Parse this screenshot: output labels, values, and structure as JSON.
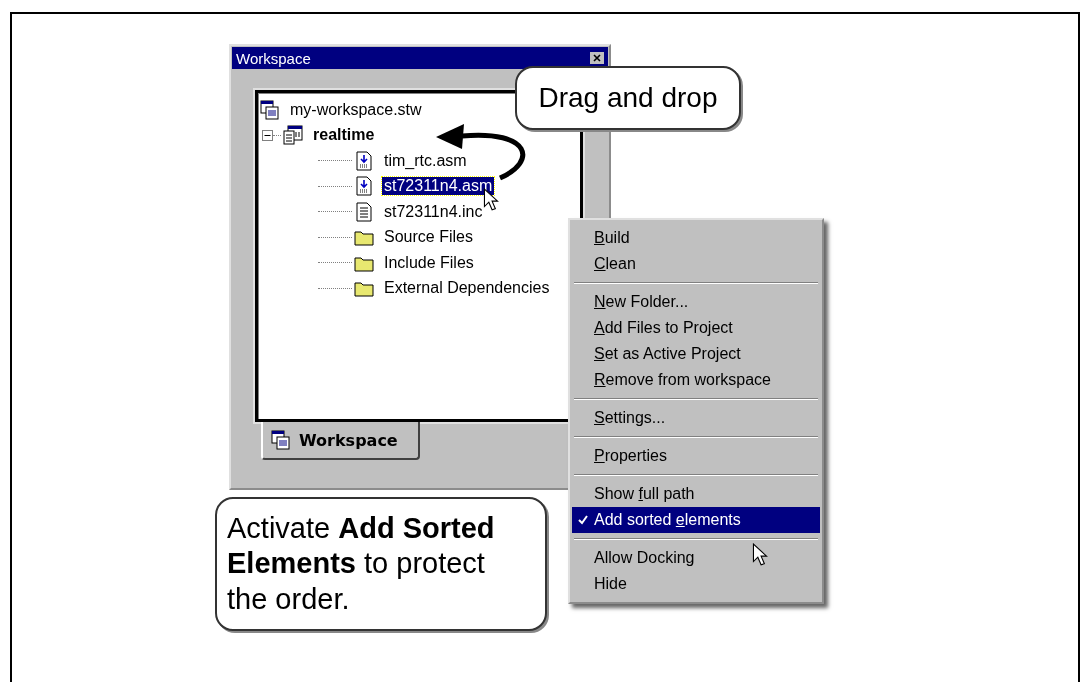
{
  "window": {
    "title": "Workspace"
  },
  "tree": [
    {
      "label": "my-workspace.stw",
      "kind": "workspace",
      "selected": false,
      "children": [
        {
          "label": "realtime",
          "kind": "project",
          "bold": true,
          "expanded": true,
          "selected": false,
          "children": [
            {
              "label": "tim_rtc.asm",
              "kind": "asm",
              "selected": false
            },
            {
              "label": "st72311n4.asm",
              "kind": "asm",
              "selected": true
            },
            {
              "label": "st72311n4.inc",
              "kind": "inc",
              "selected": false
            },
            {
              "label": "Source Files",
              "kind": "folder",
              "selected": false
            },
            {
              "label": "Include Files",
              "kind": "folder",
              "selected": false
            },
            {
              "label": "External Dependencies",
              "kind": "folder",
              "selected": false
            }
          ]
        }
      ]
    }
  ],
  "tabs": [
    {
      "label": "Workspace",
      "selected": true
    }
  ],
  "callouts": [
    {
      "text": "Drag and drop"
    },
    {
      "text": "Activate **Add Sorted Elements** to protect the order."
    }
  ],
  "context_menu": [
    {
      "kind": "item",
      "key": "B",
      "post": "uild",
      "checked": false,
      "selected": false
    },
    {
      "kind": "item",
      "key": "C",
      "post": "lean",
      "checked": false,
      "selected": false
    },
    {
      "kind": "separator"
    },
    {
      "kind": "item",
      "key": "N",
      "post": "ew Folder...",
      "checked": false,
      "selected": false
    },
    {
      "kind": "item",
      "key": "A",
      "post": "dd Files to Project",
      "checked": false,
      "selected": false
    },
    {
      "kind": "item",
      "key": "S",
      "post": "et as Active Project",
      "checked": false,
      "selected": false
    },
    {
      "kind": "item",
      "key": "R",
      "post": "emove from workspace",
      "checked": false,
      "selected": false
    },
    {
      "kind": "separator"
    },
    {
      "kind": "item",
      "key": "S",
      "post": "ettings...",
      "checked": false,
      "selected": false
    },
    {
      "kind": "separator"
    },
    {
      "kind": "item",
      "key": "P",
      "post": "roperties",
      "checked": false,
      "selected": false
    },
    {
      "kind": "separator"
    },
    {
      "kind": "item",
      "pre": "Show ",
      "key": "f",
      "post": "ull path",
      "checked": false,
      "selected": false
    },
    {
      "kind": "item",
      "pre": "Add sorted ",
      "key": "e",
      "post": "lements",
      "checked": true,
      "selected": true
    },
    {
      "kind": "separator"
    },
    {
      "kind": "item",
      "pre": "Allow Docking",
      "checked": false,
      "selected": false
    },
    {
      "kind": "item",
      "pre": "Hide",
      "checked": false,
      "selected": false
    }
  ]
}
